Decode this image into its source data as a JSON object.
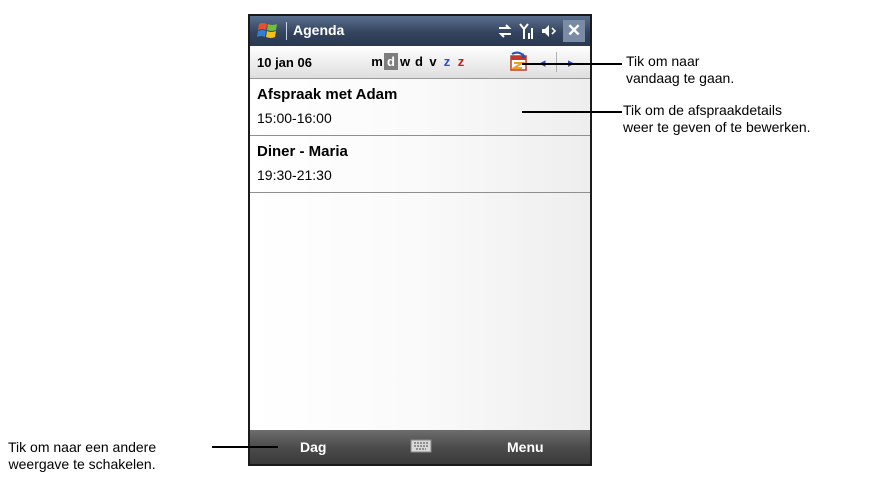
{
  "titlebar": {
    "app_title": "Agenda"
  },
  "toolbar": {
    "date": "10 jan 06",
    "days": [
      {
        "label": "m",
        "color": "#000000",
        "selected": false
      },
      {
        "label": "d",
        "color": "#ffffff",
        "selected": true
      },
      {
        "label": "w",
        "color": "#000000",
        "selected": false
      },
      {
        "label": "d",
        "color": "#000000",
        "selected": false
      },
      {
        "label": "v",
        "color": "#000000",
        "selected": false
      },
      {
        "label": "z",
        "color": "#2250c8",
        "selected": false
      },
      {
        "label": "z",
        "color": "#d01818",
        "selected": false
      }
    ]
  },
  "appointments": [
    {
      "subject": "Afspraak met Adam",
      "time": "15:00-16:00"
    },
    {
      "subject": "Diner - Maria",
      "time": "19:30-21:30"
    }
  ],
  "menubar": {
    "left": "Dag",
    "right": "Menu"
  },
  "callouts": {
    "today": [
      "Tik om naar",
      "vandaag te gaan."
    ],
    "details": [
      "Tik om de afspraakdetails",
      "weer te geven of te bewerken."
    ],
    "view": [
      "Tik om naar een andere",
      "weergave te schakelen."
    ]
  },
  "icons": {
    "start": "windows-flag-icon",
    "connectivity": "connectivity-icon",
    "signal": "signal-icon",
    "speaker": "speaker-icon",
    "close": "close-icon",
    "today": "today-calendar-icon",
    "prev": "left-arrow-icon",
    "next": "right-arrow-icon",
    "keyboard": "keyboard-icon"
  }
}
